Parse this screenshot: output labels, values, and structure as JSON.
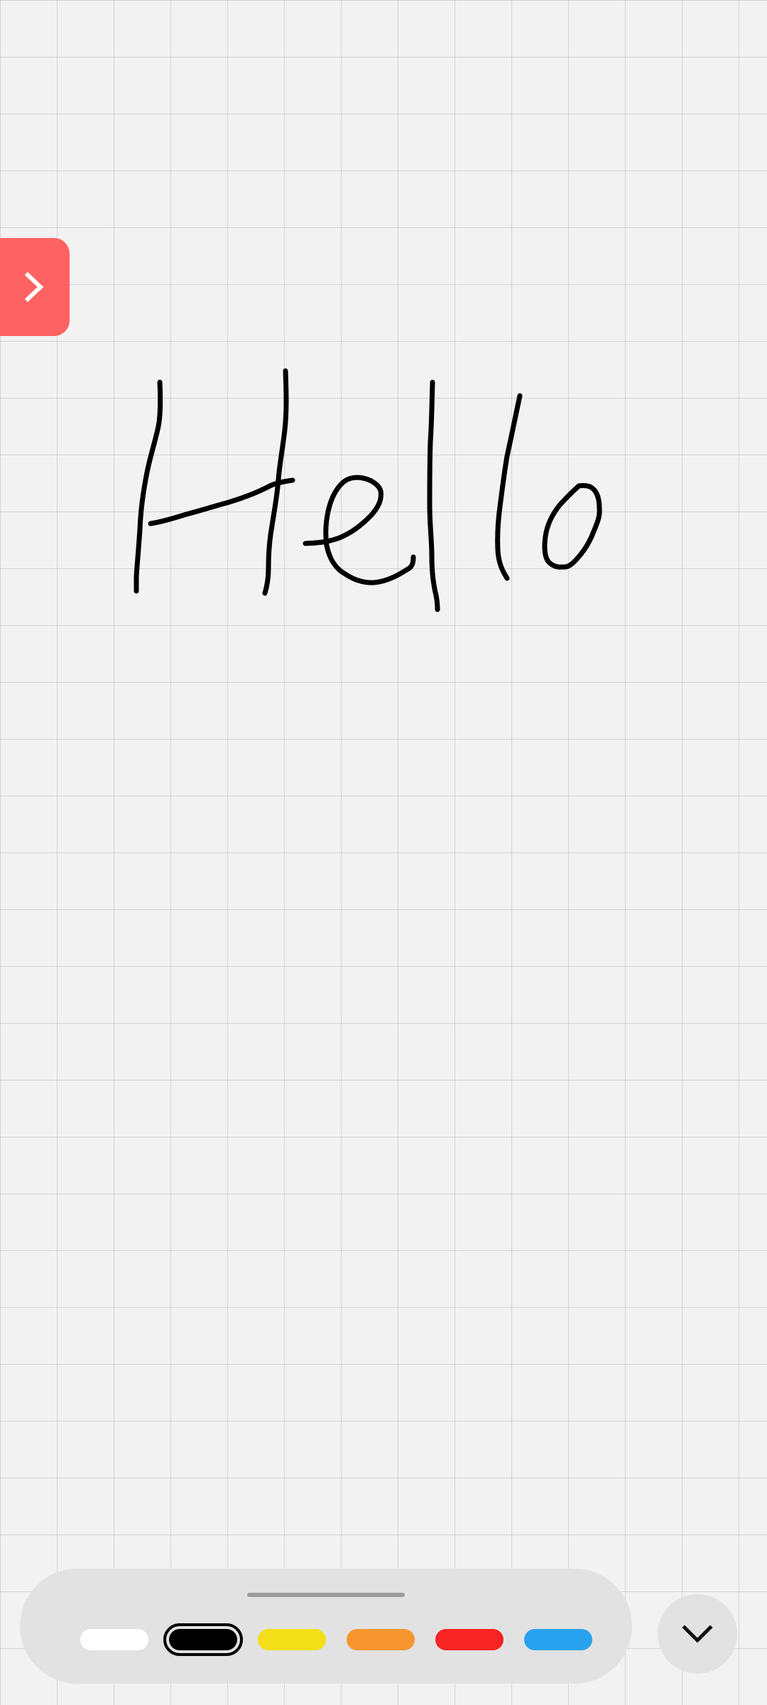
{
  "canvas": {
    "background": "#f2f2f2",
    "grid": true,
    "handwriting_text": "Hello",
    "stroke_color": "#000000"
  },
  "side_tab": {
    "icon": "chevron-right-icon",
    "color": "#ff6262"
  },
  "toolbar": {
    "background": "#e2e2e2",
    "colors": [
      {
        "name": "white",
        "hex": "#ffffff",
        "selected": false
      },
      {
        "name": "black",
        "hex": "#000000",
        "selected": true
      },
      {
        "name": "yellow",
        "hex": "#f2df17",
        "selected": false
      },
      {
        "name": "orange",
        "hex": "#f7952f",
        "selected": false
      },
      {
        "name": "red",
        "hex": "#f82323",
        "selected": false
      },
      {
        "name": "blue",
        "hex": "#28a2ee",
        "selected": false
      }
    ],
    "collapse_icon": "chevron-down-icon"
  }
}
